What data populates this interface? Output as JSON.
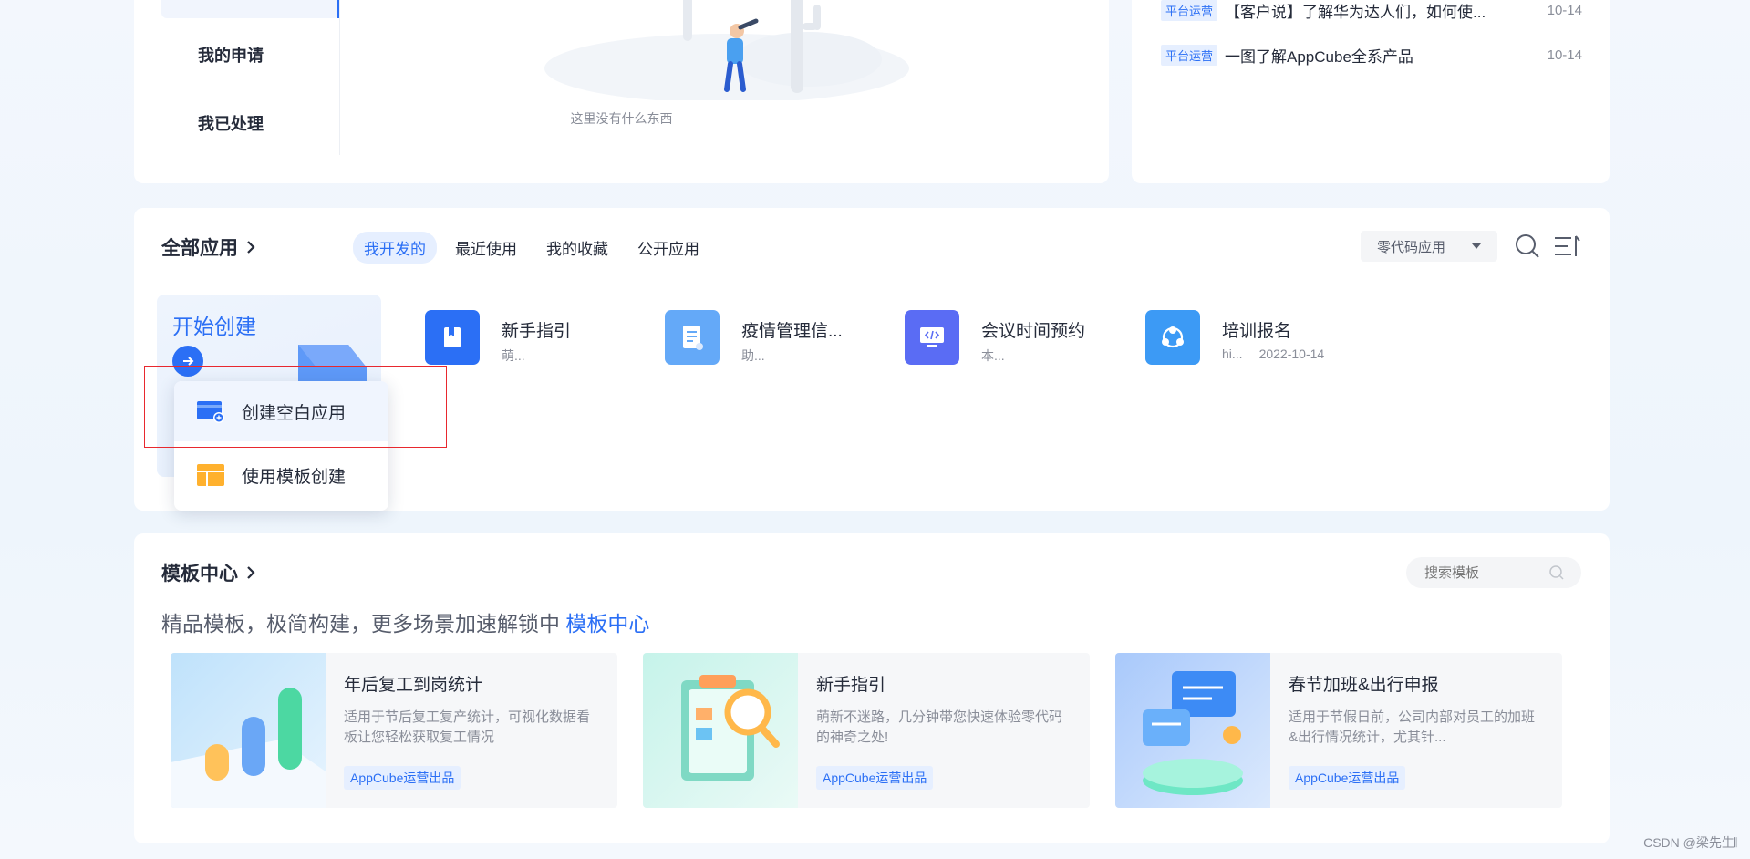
{
  "sidebar": {
    "items": [
      {
        "label": "我的申请"
      },
      {
        "label": "我已处理"
      }
    ]
  },
  "empty_state": {
    "text": "这里没有什么东西"
  },
  "news": [
    {
      "tag": "平台运营",
      "title": "【客户说】了解华为达人们，如何使...",
      "date": "10-14"
    },
    {
      "tag": "平台运营",
      "title": "一图了解AppCube全系产品",
      "date": "10-14"
    }
  ],
  "apps": {
    "title": "全部应用",
    "tabs": [
      "我开发的",
      "最近使用",
      "我的收藏",
      "公开应用"
    ],
    "active_tab": 0,
    "filter": {
      "selected": "零代码应用"
    },
    "start_card": {
      "label": "开始创建"
    },
    "items": [
      {
        "name": "新手指引",
        "sub": "萌...",
        "date": "",
        "color": "#2b6ff5"
      },
      {
        "name": "疫情管理信...",
        "sub": "助...",
        "date": "",
        "color": "#64a9f8"
      },
      {
        "name": "会议时间预约",
        "sub": "本...",
        "date": "",
        "color": "#5a6cf4"
      },
      {
        "name": "培训报名",
        "sub": "hi...",
        "date": "2022-10-14",
        "color": "#3c9af5"
      }
    ]
  },
  "create_menu": {
    "items": [
      {
        "label": "创建空白应用"
      },
      {
        "label": "使用模板创建"
      }
    ]
  },
  "templates": {
    "title": "模板中心",
    "search_placeholder": "搜索模板",
    "desc_prefix": "精品模板，极简构建，更多场景加速解锁中",
    "desc_link": "模板中心",
    "cards": [
      {
        "name": "年后复工到岗统计",
        "desc": "适用于节后复工复产统计，可视化数据看板让您轻松获取复工情况",
        "badge": "AppCube运营出品"
      },
      {
        "name": "新手指引",
        "desc": "萌新不迷路，几分钟带您快速体验零代码的神奇之处!",
        "badge": "AppCube运营出品"
      },
      {
        "name": "春节加班&出行申报",
        "desc": "适用于节假日前，公司内部对员工的加班&出行情况统计，尤其针...",
        "badge": "AppCube运营出品"
      }
    ]
  },
  "watermark": "CSDN @梁先生𝄃"
}
